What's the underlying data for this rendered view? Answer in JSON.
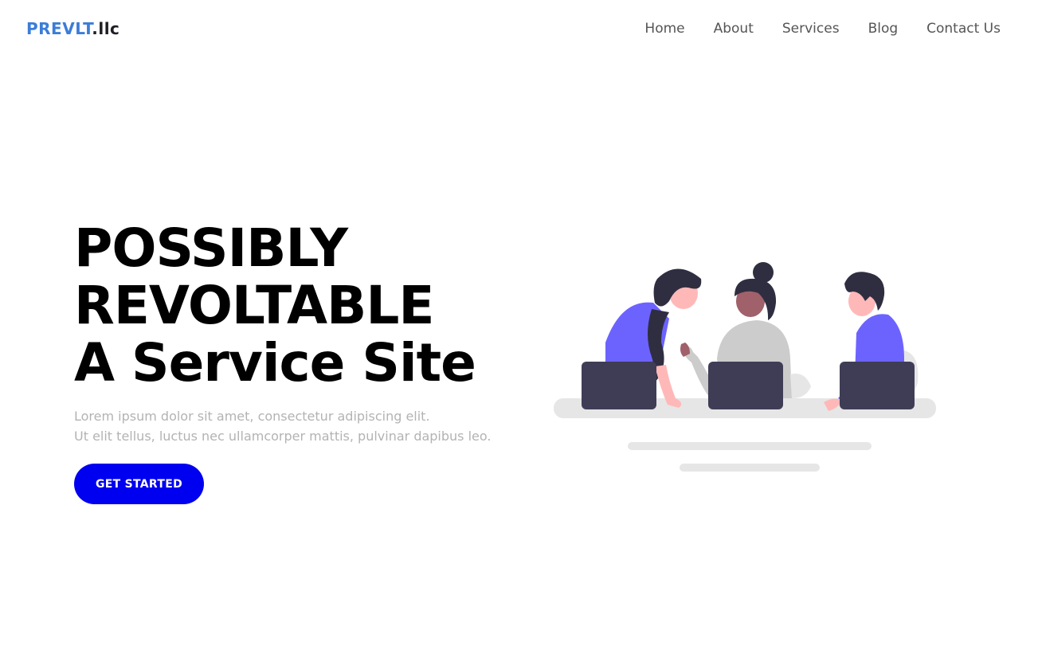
{
  "header": {
    "logo_brand": "PREVLT",
    "logo_suffix": ".llc",
    "nav": [
      {
        "label": "Home"
      },
      {
        "label": "About"
      },
      {
        "label": "Services"
      },
      {
        "label": "Blog"
      },
      {
        "label": "Contact Us"
      }
    ]
  },
  "hero": {
    "title_lines": [
      "POSSIBLY",
      "REVOLTABLE",
      "A Service Site"
    ],
    "subtitle_lines": [
      "Lorem ipsum dolor sit amet, consectetur adipiscing elit.",
      "Ut elit tellus, luctus nec ullamcorper mattis, pulvinar dapibus leo."
    ],
    "cta_label": "GET STARTED"
  },
  "illustration": {
    "icon": "team-at-laptops-illustration"
  },
  "colors": {
    "brand": "#3b7dd8",
    "cta": "#0000f0",
    "accent_purple": "#6c63ff",
    "laptop": "#3f3d56"
  }
}
